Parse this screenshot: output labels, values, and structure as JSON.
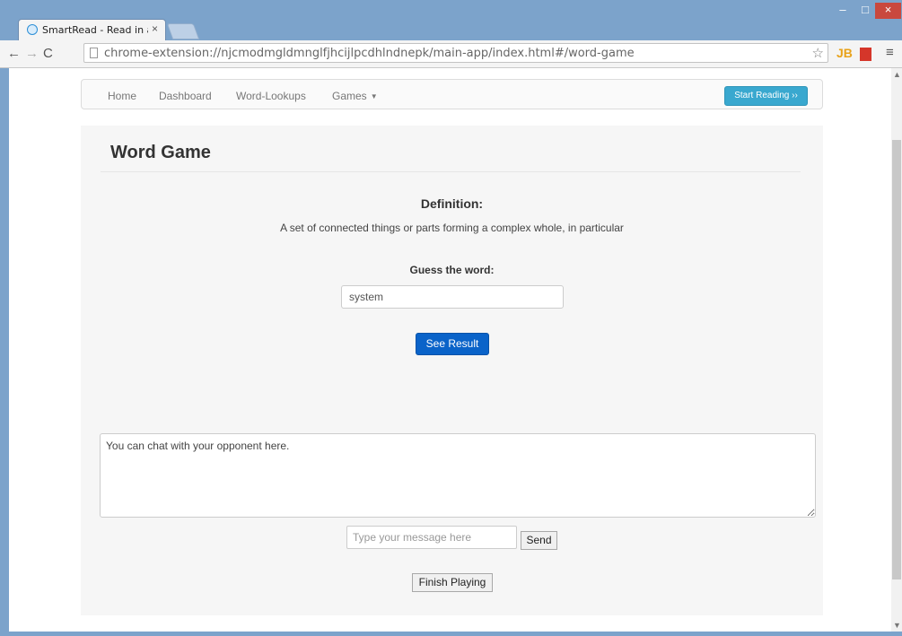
{
  "browser": {
    "tab_title": "SmartRead - Read in a sm",
    "tab_close": "×",
    "url": "chrome-extension://njcmodmgldmnglfjhcijlpcdhlndnepk/main-app/index.html#/word-game",
    "back": "←",
    "forward": "→",
    "reload": "C",
    "star": "☆",
    "ext_jb": "JB",
    "menu": "≡",
    "minimize": "–",
    "maximize": "□",
    "close": "×"
  },
  "navbar": {
    "items": [
      {
        "label": "Home"
      },
      {
        "label": "Dashboard"
      },
      {
        "label": "Word-Lookups"
      },
      {
        "label": "Games"
      }
    ],
    "start_button": "Start Reading ››"
  },
  "game": {
    "title": "Word Game",
    "definition_label": "Definition:",
    "definition_text": "A set of connected things or parts forming a complex whole, in particular",
    "guess_label": "Guess the word:",
    "guess_value": "system",
    "result_button": "See Result"
  },
  "chat": {
    "box_text": "You can chat with your opponent here.",
    "message_placeholder": "Type your message here",
    "send_button": "Send",
    "finish_button": "Finish Playing"
  }
}
